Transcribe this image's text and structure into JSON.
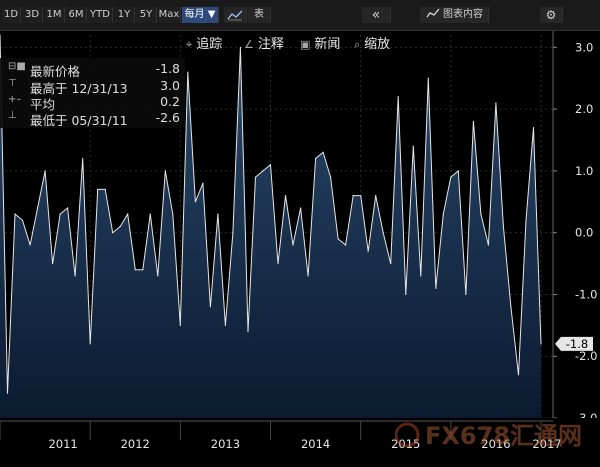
{
  "toolbar": {
    "ranges": [
      "1D",
      "3D",
      "1M",
      "6M",
      "YTD",
      "1Y",
      "5Y",
      "Max"
    ],
    "frequency": "每月 ▼",
    "table_label": "表",
    "collapse_glyph": "«",
    "chart_content_label": "图表内容",
    "settings_glyph": "⚙"
  },
  "subtoolbar": {
    "track": "追踪",
    "annotate": "注释",
    "news": "新闻",
    "zoom": "缩放"
  },
  "legend": {
    "last_label": "最新价格",
    "last_value": "-1.8",
    "high_label": "最高于 12/31/13",
    "high_value": "3.0",
    "avg_label": "平均",
    "avg_value": "0.2",
    "low_label": "最低于 05/31/11",
    "low_value": "-2.6"
  },
  "current_value_tag": "-1.8",
  "watermark": "FX678汇通网",
  "colors": {
    "line": "#e6e6e6",
    "fill_top": "#2a4a6e",
    "fill_bottom": "#0b1a30",
    "tag_bg": "#e6e6e6"
  },
  "chart_data": {
    "type": "area",
    "title": "",
    "xlabel": "",
    "ylabel": "",
    "ylim": [
      -3.0,
      3.2
    ],
    "yticks": [
      "3.0",
      "2.0",
      "1.0",
      "0.0",
      "-1.0",
      "-2.0",
      "-3.0"
    ],
    "year_labels": [
      "2011",
      "2012",
      "2013",
      "2014",
      "2015",
      "2016",
      "2017"
    ],
    "x": [
      "2011-01",
      "2011-02",
      "2011-03",
      "2011-04",
      "2011-05",
      "2011-06",
      "2011-07",
      "2011-08",
      "2011-09",
      "2011-10",
      "2011-11",
      "2011-12",
      "2012-01",
      "2012-02",
      "2012-03",
      "2012-04",
      "2012-05",
      "2012-06",
      "2012-07",
      "2012-08",
      "2012-09",
      "2012-10",
      "2012-11",
      "2012-12",
      "2013-01",
      "2013-02",
      "2013-03",
      "2013-04",
      "2013-05",
      "2013-06",
      "2013-07",
      "2013-08",
      "2013-09",
      "2013-10",
      "2013-11",
      "2013-12",
      "2014-01",
      "2014-02",
      "2014-03",
      "2014-04",
      "2014-05",
      "2014-06",
      "2014-07",
      "2014-08",
      "2014-09",
      "2014-10",
      "2014-11",
      "2014-12",
      "2015-01",
      "2015-02",
      "2015-03",
      "2015-04",
      "2015-05",
      "2015-06",
      "2015-07",
      "2015-08",
      "2015-09",
      "2015-10",
      "2015-11",
      "2015-12",
      "2016-01",
      "2016-02",
      "2016-03",
      "2016-04",
      "2016-05",
      "2016-06",
      "2016-07",
      "2016-08",
      "2016-09",
      "2016-10",
      "2016-11",
      "2016-12",
      "2017-01"
    ],
    "values": [
      3.2,
      -2.6,
      0.3,
      0.2,
      -0.2,
      0.4,
      1.0,
      -0.5,
      0.3,
      0.4,
      -0.7,
      1.2,
      -1.8,
      0.7,
      0.7,
      0.0,
      0.1,
      0.3,
      -0.6,
      -0.6,
      0.3,
      -0.7,
      1.0,
      0.3,
      -1.5,
      2.6,
      0.5,
      0.8,
      -1.2,
      0.3,
      -1.5,
      0.0,
      3.0,
      -1.6,
      0.9,
      1.0,
      1.1,
      -0.5,
      0.6,
      -0.2,
      0.4,
      -0.7,
      1.2,
      1.3,
      0.9,
      -0.1,
      -0.2,
      0.6,
      0.6,
      -0.3,
      0.6,
      0.0,
      -0.5,
      2.2,
      -1.0,
      1.4,
      -0.7,
      2.5,
      -0.9,
      0.3,
      0.9,
      1.0,
      -1.0,
      1.8,
      0.3,
      -0.2,
      2.1,
      0.1,
      -1.2,
      -2.3,
      0.2,
      1.7,
      -1.8
    ]
  }
}
